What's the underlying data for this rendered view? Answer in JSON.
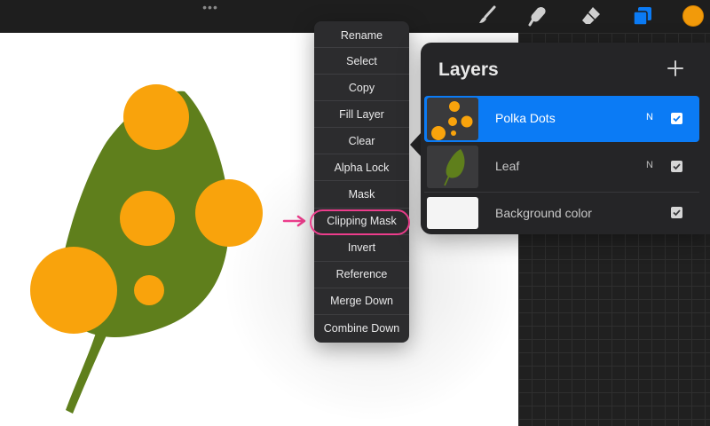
{
  "topbar": {
    "more_label": "•••",
    "tools": [
      {
        "icon": "brush-icon"
      },
      {
        "icon": "smudge-icon"
      },
      {
        "icon": "eraser-icon"
      },
      {
        "icon": "layers-icon"
      }
    ],
    "current_color": "#f29a0a"
  },
  "context_menu": {
    "items": [
      "Rename",
      "Select",
      "Copy",
      "Fill Layer",
      "Clear",
      "Alpha Lock",
      "Mask",
      "Clipping Mask",
      "Invert",
      "Reference",
      "Merge Down",
      "Combine Down"
    ],
    "highlighted_item": "Clipping Mask",
    "highlight_color": "#ec3d8c"
  },
  "layers_panel": {
    "title": "Layers",
    "add_icon": "plus-icon",
    "layers": [
      {
        "name": "Polka Dots",
        "blend_mode": "N",
        "visible": true,
        "selected": true
      },
      {
        "name": "Leaf",
        "blend_mode": "N",
        "visible": true,
        "selected": false
      },
      {
        "name": "Background color",
        "blend_mode": "",
        "visible": true,
        "selected": false
      }
    ],
    "accent": "#0b7bf5"
  },
  "artwork": {
    "leaf_color": "#5f7f1c",
    "dot_color": "#f9a30c"
  }
}
